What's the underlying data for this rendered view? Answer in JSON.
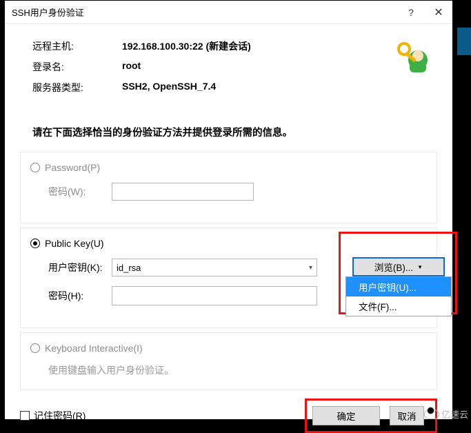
{
  "title": "SSH用户身份验证",
  "info": {
    "remote_label": "远程主机:",
    "remote_value": "192.168.100.30:22 (新建会话)",
    "login_label": "登录名:",
    "login_value": "root",
    "type_label": "服务器类型:",
    "type_value": "SSH2, OpenSSH_7.4"
  },
  "instruction": "请在下面选择恰当的身份验证方法并提供登录所需的信息。",
  "password_group": {
    "radio": "Password(P)",
    "pwd_label": "密码(W):"
  },
  "pubkey_group": {
    "radio": "Public Key(U)",
    "key_label": "用户密钥(K):",
    "key_value": "id_rsa",
    "pwd_label": "密码(H):",
    "browse": "浏览(B)...",
    "menu_user_key": "用户密钥(U)...",
    "menu_file": "文件(F)..."
  },
  "kbd_group": {
    "radio": "Keyboard Interactive(I)",
    "hint": "使用键盘输入用户身份验证。"
  },
  "footer": {
    "remember": "记住密码(R)",
    "ok": "确定",
    "cancel": "取消"
  },
  "watermark": "亿速云"
}
